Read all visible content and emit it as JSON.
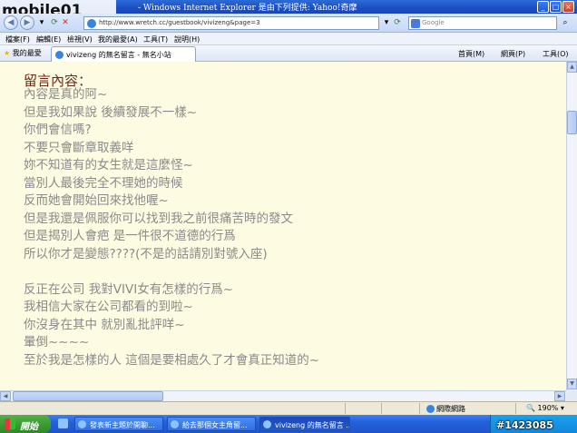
{
  "window": {
    "logo_text": "mobile01",
    "title": "- Windows Internet Explorer 是由下列提供: Yahoo!奇摩",
    "buttons": {
      "minimize": "_",
      "maximize": "□",
      "close": "×"
    }
  },
  "address_bar": {
    "url": "http://www.wretch.cc/guestbook/vivizeng&page=3",
    "search_placeholder": "Google"
  },
  "menu": [
    "檔案(F)",
    "編輯(E)",
    "檢視(V)",
    "我的最愛(A)",
    "工具(T)",
    "說明(H)"
  ],
  "favorites_bar": {
    "favorites_label": "我的最愛",
    "tab_title": "vivizeng 的無名留言 - 無名小站",
    "tools": [
      "首頁(M)",
      "網頁(P)",
      "工具(O)"
    ]
  },
  "content": {
    "heading": "留言內容：",
    "lines": [
      "內容是真的阿~",
      "但是我如果說 後續發展不一樣~",
      "你們會信嗎?",
      "不要只會斷章取義咩",
      "妳不知道有的女生就是這麼怪~",
      "當別人最後完全不理她的時候",
      "反而她會開始回來找他喔~",
      "但是我還是佩服你可以找到我之前很痛苦時的發文",
      "但是揭別人會疤 是一件很不道德的行爲",
      "所以你才是變態????(不是的話請別對號入座)",
      "",
      "反正在公司 我對VIVI女有怎樣的行爲~",
      "我相信大家在公司都看的到啦~",
      "你沒身在其中 就別亂批評咩~",
      "暈倒~~~~",
      "至於我是怎樣的人 這個是要相處久了才會真正知道的~"
    ]
  },
  "status_bar": {
    "zone": "網際網路",
    "zoom": "190%"
  },
  "taskbar": {
    "start_label": "開始",
    "tasks": [
      "發表新主題於開聊...",
      "給去那個女主角留...",
      "vivizeng 的無名留言 ..."
    ]
  },
  "watermark": "#1423085"
}
